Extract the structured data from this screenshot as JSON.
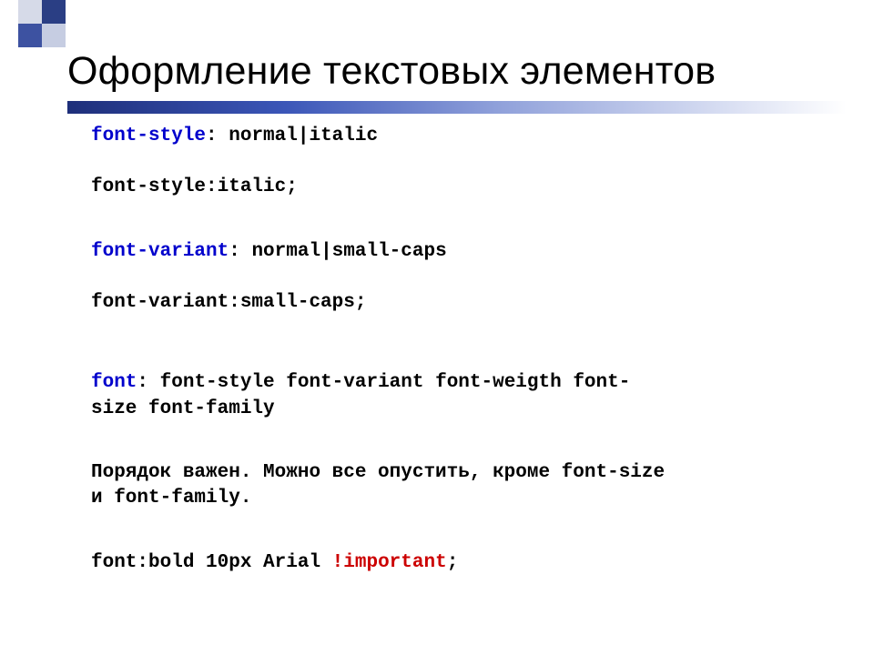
{
  "title": "Оформление текстовых элементов",
  "l1_prop": "font-style",
  "l1_colon": ": ",
  "l1_vals": "normal|italic",
  "l2": "font-style:italic;",
  "l3_prop": "font-variant",
  "l3_colon": ": ",
  "l3_vals": "normal|small-caps",
  "l4": "font-variant:small-caps;",
  "l5_prop": "font",
  "l5_colon": ": ",
  "l5_vals1": "font-style font-variant font-weigth  font-",
  "l5_vals2": "size font-family",
  "l6a": "Порядок важен. Можно все опустить, кроме font-size",
  "l6b": "и font-family.",
  "l7_left": "font:bold 10px Arial ",
  "l7_imp": "!important",
  "l7_semi": ";"
}
